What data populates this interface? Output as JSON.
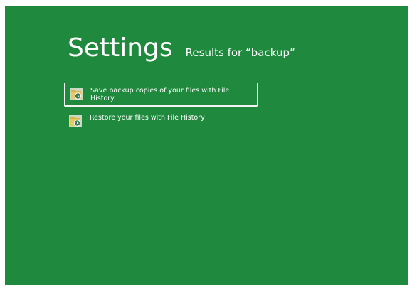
{
  "header": {
    "title": "Settings",
    "results_prefix": "Results for ",
    "query": "“backup”"
  },
  "results": [
    {
      "label": "Save backup copies of your files with File History",
      "icon": "file-history-icon",
      "selected": true
    },
    {
      "label": "Restore your files with File History",
      "icon": "file-history-icon",
      "selected": false
    }
  ],
  "colors": {
    "background": "#1f8a3d",
    "icon_folder": "#d8b24a",
    "icon_accent": "#3a7d5a",
    "text": "#ffffff"
  }
}
